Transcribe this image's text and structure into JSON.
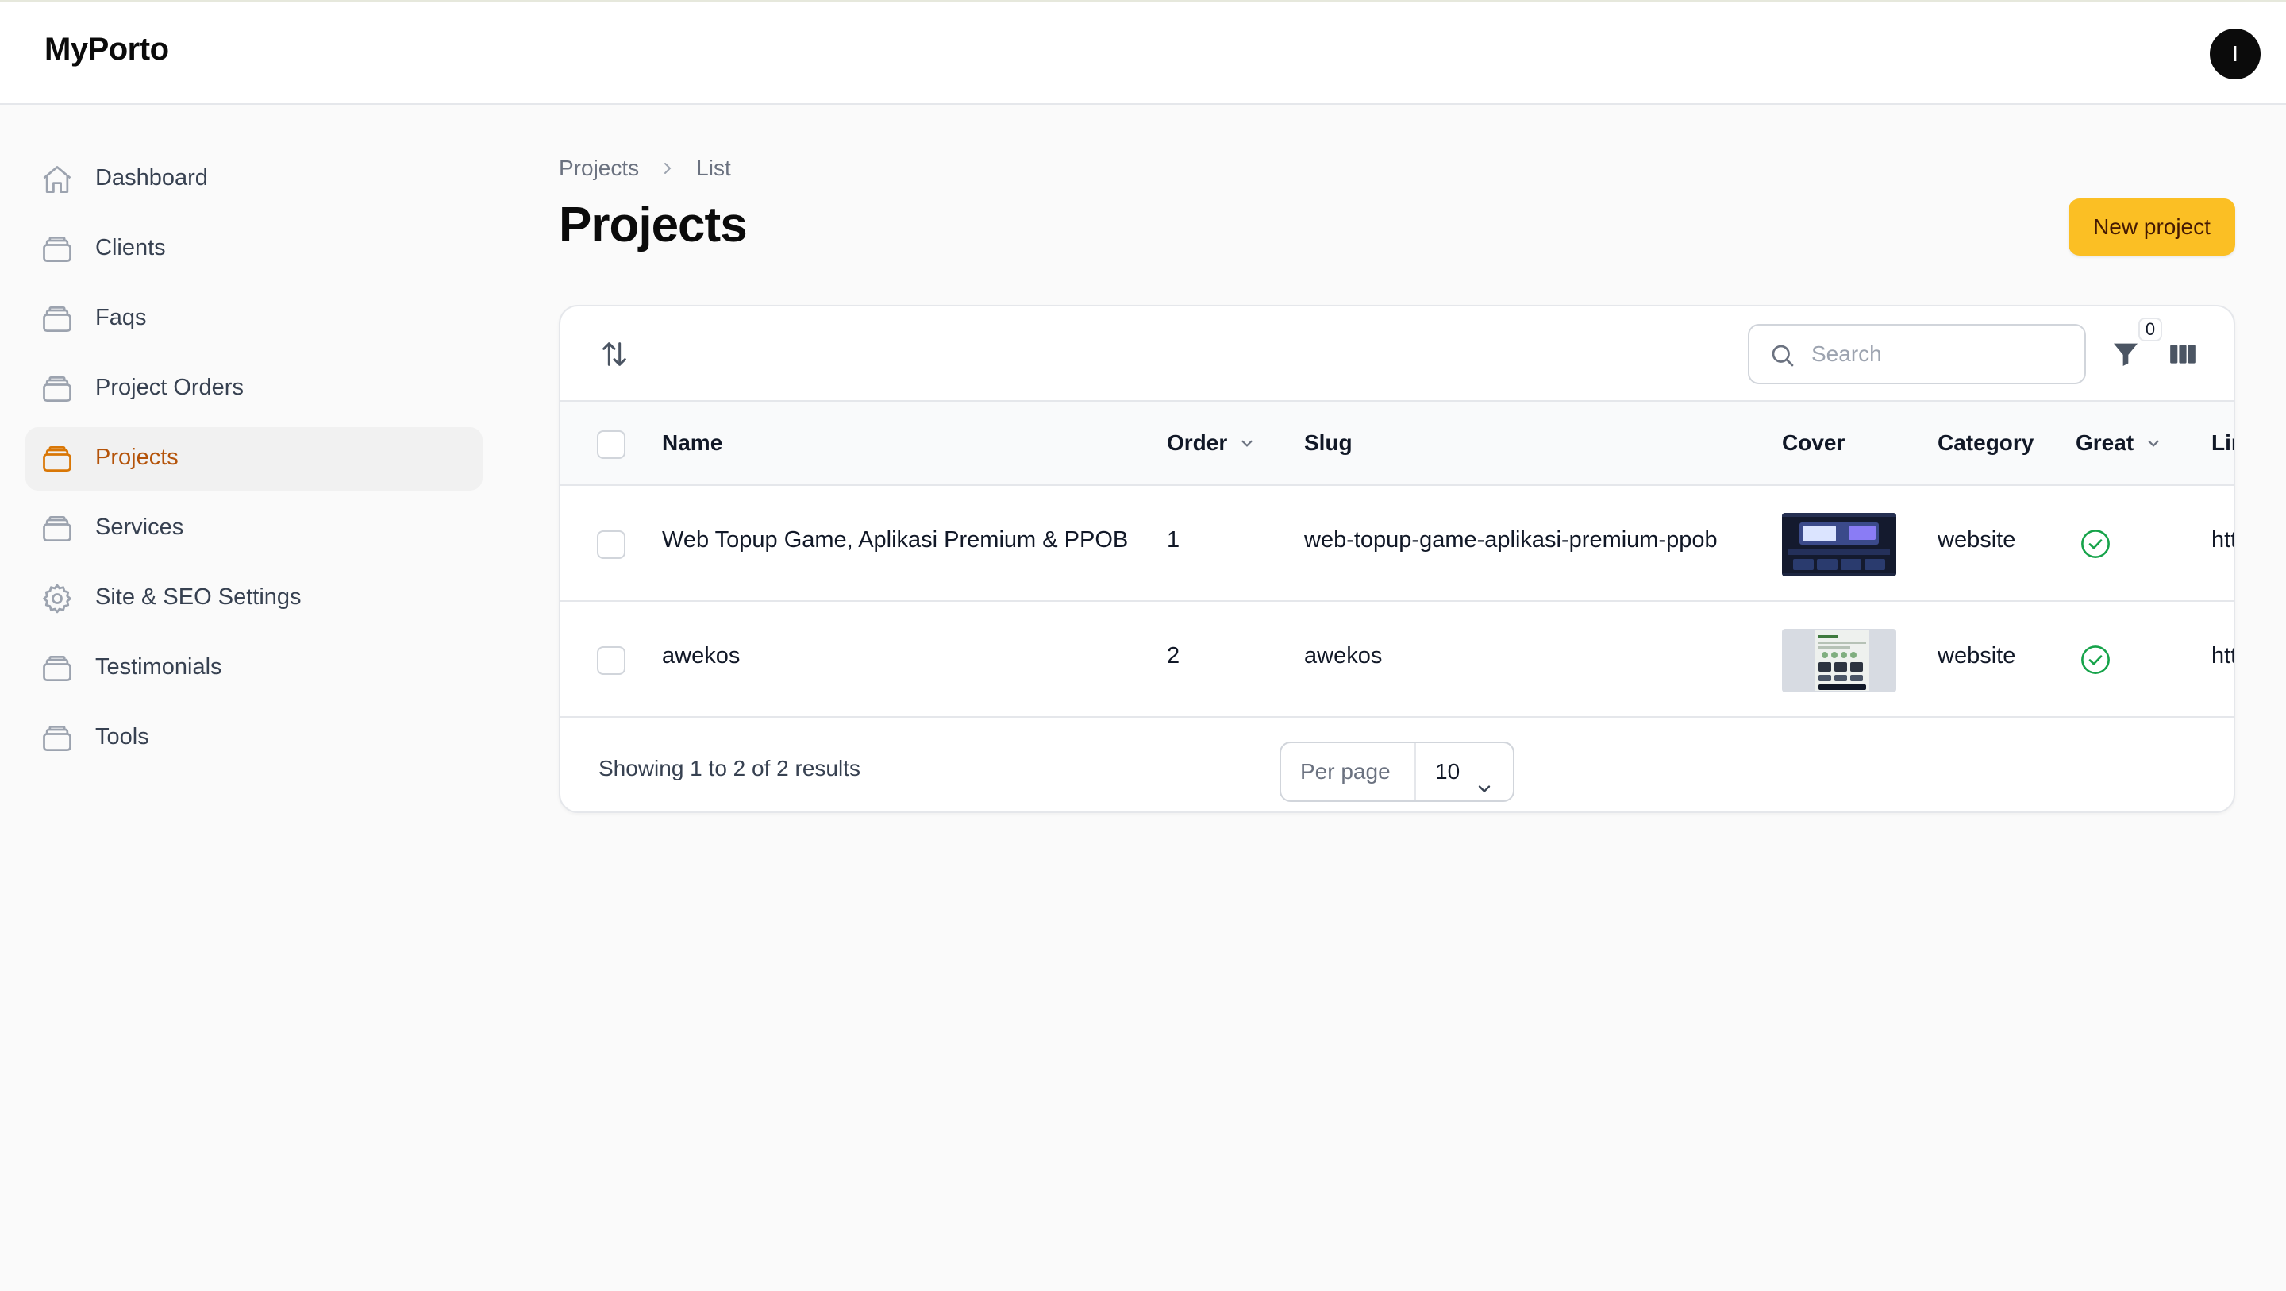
{
  "app": {
    "brand": "MyPorto",
    "avatar_initial": "I"
  },
  "sidebar": {
    "items": [
      {
        "label": "Dashboard",
        "icon": "home-icon"
      },
      {
        "label": "Clients",
        "icon": "stack-icon"
      },
      {
        "label": "Faqs",
        "icon": "stack-icon"
      },
      {
        "label": "Project Orders",
        "icon": "stack-icon"
      },
      {
        "label": "Projects",
        "icon": "stack-icon",
        "active": true
      },
      {
        "label": "Services",
        "icon": "stack-icon"
      },
      {
        "label": "Site & SEO Settings",
        "icon": "gear-icon"
      },
      {
        "label": "Testimonials",
        "icon": "stack-icon"
      },
      {
        "label": "Tools",
        "icon": "stack-icon"
      }
    ]
  },
  "breadcrumb": {
    "items": [
      "Projects",
      "List"
    ]
  },
  "page": {
    "title": "Projects",
    "new_button": "New project"
  },
  "table": {
    "search_placeholder": "Search",
    "filter_count": "0",
    "columns": [
      "Name",
      "Order",
      "Slug",
      "Cover",
      "Category",
      "Great",
      "Lir"
    ],
    "rows": [
      {
        "name": "Web Topup Game, Aplikasi Premium & PPOB",
        "order": "1",
        "slug": "web-topup-game-aplikasi-premium-ppob",
        "category": "website",
        "great": true,
        "link": "htt"
      },
      {
        "name": "awekos",
        "order": "2",
        "slug": "awekos",
        "category": "website",
        "great": true,
        "link": "htt"
      }
    ],
    "result_text": "Showing 1 to 2 of 2 results",
    "per_page_label": "Per page",
    "per_page_value": "10"
  },
  "colors": {
    "accent": "#fbbf24",
    "active_text": "#b45309",
    "success": "#16a34a"
  }
}
